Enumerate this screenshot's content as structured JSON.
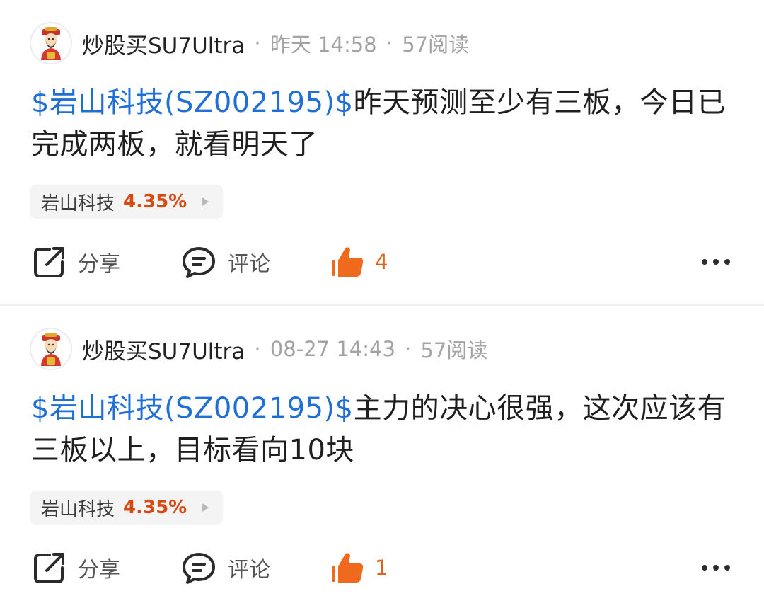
{
  "colors": {
    "stock_link": "#1f6fd6",
    "price_up": "#d94a12",
    "like_accent": "#f06a1d",
    "meta_gray": "#a3a3a3"
  },
  "posts": [
    {
      "author": "炒股买SU7Ultra",
      "dot1": "·",
      "time": "昨天 14:58",
      "dot2": "·",
      "reads": "57阅读",
      "stock_tag": "$岩山科技(SZ002195)$",
      "text": "昨天预测至少有三板，今日已完成两板，就看明天了",
      "chip_name": "岩山科技",
      "chip_change": "4.35%",
      "share_label": "分享",
      "comment_label": "评论",
      "like_count": "4"
    },
    {
      "author": "炒股买SU7Ultra",
      "dot1": "·",
      "time": "08-27 14:43",
      "dot2": "·",
      "reads": "57阅读",
      "stock_tag": "$岩山科技(SZ002195)$",
      "text": "主力的决心很强，这次应该有三板以上，目标看向10块",
      "chip_name": "岩山科技",
      "chip_change": "4.35%",
      "share_label": "分享",
      "comment_label": "评论",
      "like_count": "1"
    }
  ],
  "icons": {
    "avatar": "god-of-wealth-avatar-icon",
    "share": "share-icon",
    "comment": "comment-bubble-icon",
    "like": "thumbs-up-icon",
    "more": "more-dots-icon",
    "chip_arrow": "play-arrow-icon"
  }
}
